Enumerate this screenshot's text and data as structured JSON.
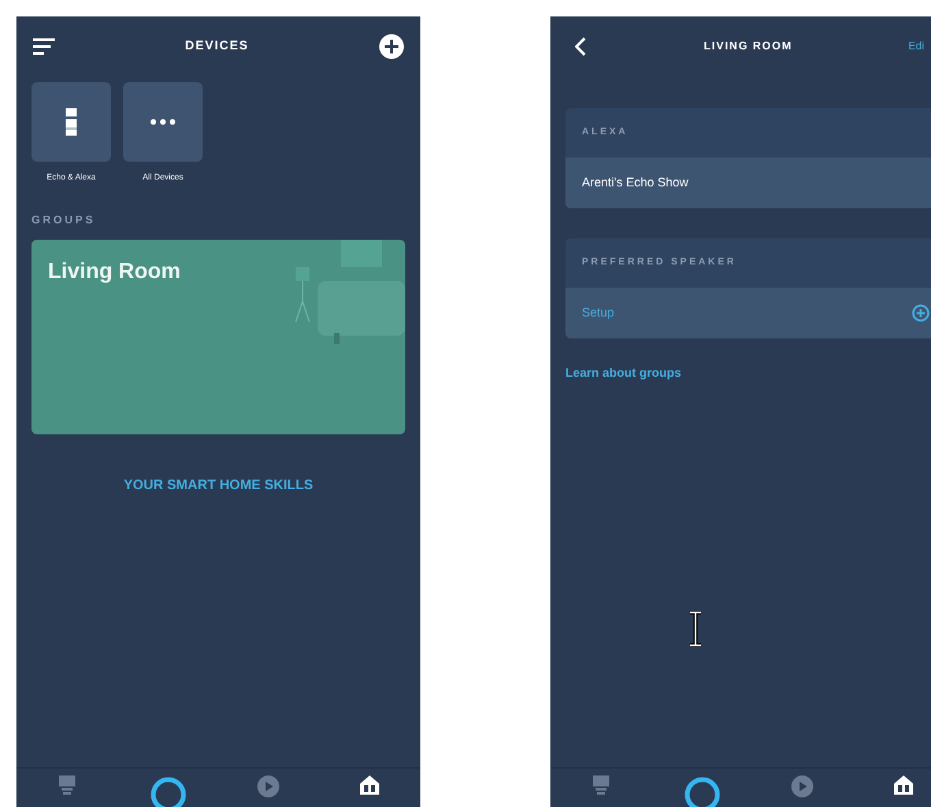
{
  "devices_screen": {
    "title": "DEVICES",
    "tiles": [
      {
        "kind": "echo",
        "label": "Echo & Alexa"
      },
      {
        "kind": "all",
        "label": "All Devices"
      }
    ],
    "groups_heading": "GROUPS",
    "group_card": {
      "title": "Living Room"
    },
    "skills_link": "YOUR SMART HOME SKILLS",
    "nav": [
      {
        "kind": "bulb",
        "selected": false
      },
      {
        "kind": "alexa",
        "selected": false
      },
      {
        "kind": "play",
        "selected": false
      },
      {
        "kind": "home",
        "selected": true
      }
    ]
  },
  "group_screen": {
    "title": "LIVING ROOM",
    "edit": "Edi",
    "sections": [
      {
        "heading": "ALEXA",
        "row": {
          "label": "Arenti's Echo Show",
          "kind": "item"
        }
      },
      {
        "heading": "PREFERRED SPEAKER",
        "row": {
          "label": "Setup",
          "kind": "add"
        }
      }
    ],
    "learn_link": "Learn about groups",
    "nav": [
      {
        "kind": "bulb",
        "selected": false
      },
      {
        "kind": "alexa",
        "selected": false
      },
      {
        "kind": "play",
        "selected": false
      },
      {
        "kind": "home",
        "selected": true
      }
    ]
  }
}
